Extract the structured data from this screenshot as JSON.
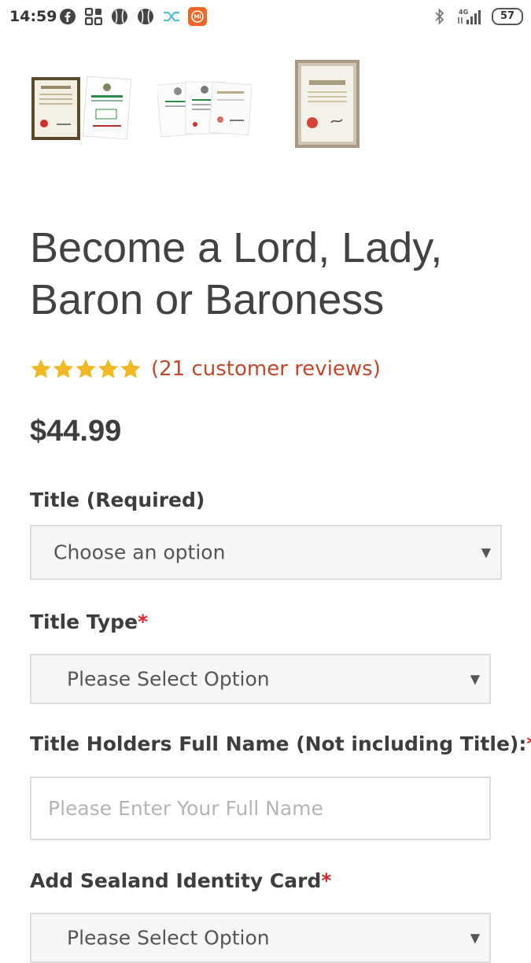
{
  "status_bar": {
    "time": "14:59",
    "network": "4G",
    "battery": "57"
  },
  "gallery": {
    "icons": [
      "certificate-frame-icon",
      "certificate-set-icon",
      "framed-certificate-icon"
    ]
  },
  "product": {
    "title": "Become a Lord, Lady, Baron or Baroness",
    "rating": 5,
    "reviews_text": "(21 customer reviews)",
    "price": "$44.99"
  },
  "form": {
    "title_label": "Title (Required)",
    "title_select_value": "Choose an option",
    "title_type_label": "Title Type",
    "title_type_value": "Please Select Option",
    "full_name_label": "Title Holders Full Name (Not including Title):",
    "full_name_placeholder": "Please Enter Your Full Name",
    "identity_card_label": "Add Sealand Identity Card",
    "identity_card_value": "Please Select Option",
    "required_mark": "*"
  },
  "colors": {
    "accent": "#c0492e",
    "star": "#f2b824",
    "required": "#e2202b"
  }
}
